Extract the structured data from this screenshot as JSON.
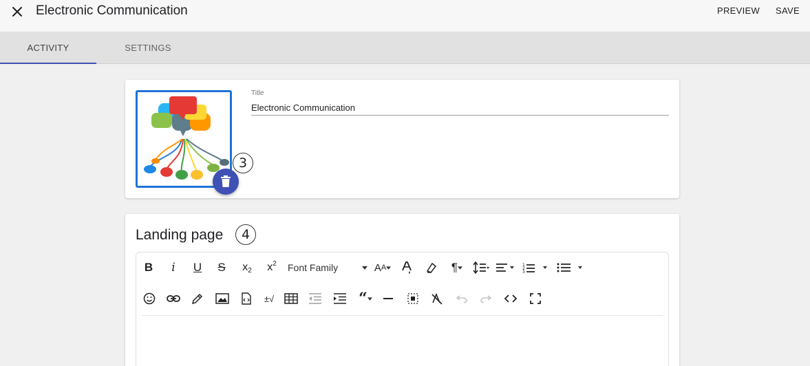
{
  "header": {
    "title": "Electronic Communication",
    "preview_label": "PREVIEW",
    "save_label": "SAVE",
    "close_icon": "close-icon"
  },
  "tabs": [
    {
      "label": "ACTIVITY",
      "active": true
    },
    {
      "label": "SETTINGS",
      "active": false
    }
  ],
  "activity": {
    "title_label": "Title",
    "title_value": "Electronic Communication",
    "thumbnail_icon": "speech-bubbles-network-image",
    "delete_icon": "trash-icon",
    "callout_image": "3"
  },
  "landing": {
    "heading": "Landing page",
    "callout": "4",
    "toolbar": {
      "font_family_label": "Font Family",
      "row1_icons": [
        "bold-icon",
        "italic-icon",
        "underline-icon",
        "strikethrough-icon",
        "subscript-icon",
        "superscript-icon",
        "font-family-dropdown",
        "font-size-icon",
        "text-color-icon",
        "highlight-icon",
        "paragraph-format-icon",
        "line-height-icon",
        "align-icon",
        "ordered-list-icon",
        "unordered-list-icon"
      ],
      "row2_icons": [
        "emoticon-icon",
        "link-icon",
        "pencil-icon",
        "image-icon",
        "file-icon",
        "special-characters-icon",
        "table-icon",
        "outdent-icon",
        "indent-icon",
        "quote-icon",
        "horizontal-line-icon",
        "select-all-icon",
        "clear-formatting-icon",
        "undo-icon",
        "redo-icon",
        "code-view-icon",
        "fullscreen-icon"
      ]
    }
  },
  "colors": {
    "accent": "#3f51b5",
    "thumb_border": "#1e73d6",
    "tabbar": "#e1e1e1"
  }
}
